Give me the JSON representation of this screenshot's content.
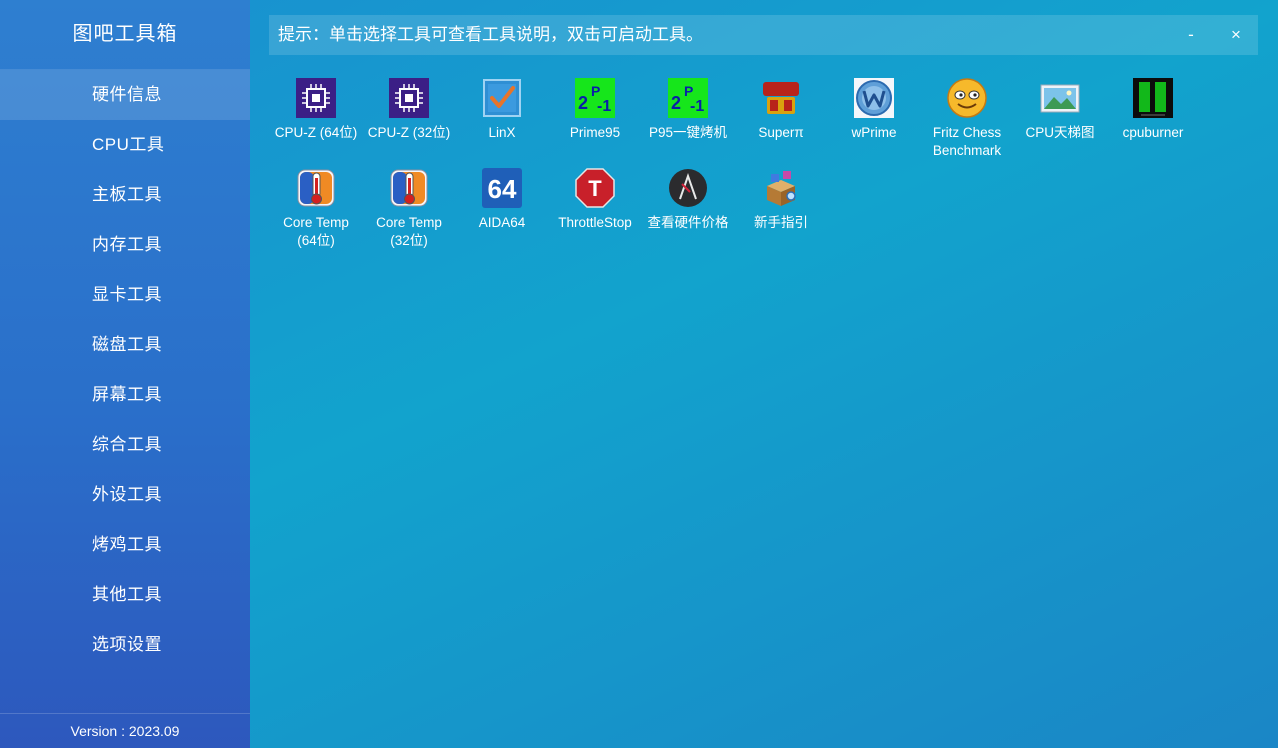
{
  "app": {
    "title": "图吧工具箱",
    "version": "Version : 2023.09"
  },
  "sidebar": {
    "items": [
      {
        "label": "硬件信息",
        "active": true
      },
      {
        "label": "CPU工具"
      },
      {
        "label": "主板工具"
      },
      {
        "label": "内存工具"
      },
      {
        "label": "显卡工具"
      },
      {
        "label": "磁盘工具"
      },
      {
        "label": "屏幕工具"
      },
      {
        "label": "综合工具"
      },
      {
        "label": "外设工具"
      },
      {
        "label": "烤鸡工具"
      },
      {
        "label": "其他工具"
      },
      {
        "label": "选项设置"
      }
    ]
  },
  "hint": {
    "text": "提示：单击选择工具可查看工具说明，双击可启动工具。",
    "minimize": "-",
    "close": "×"
  },
  "tools": [
    {
      "label": "CPU-Z (64位)",
      "icon": "cpuz-chip-icon"
    },
    {
      "label": "CPU-Z (32位)",
      "icon": "cpuz-chip-icon"
    },
    {
      "label": "LinX",
      "icon": "linx-checkbox-icon"
    },
    {
      "label": "Prime95",
      "icon": "prime95-icon"
    },
    {
      "label": "P95一键烤机",
      "icon": "prime95-icon"
    },
    {
      "label": "Superπ",
      "icon": "superpi-icon"
    },
    {
      "label": "wPrime",
      "icon": "wprime-icon"
    },
    {
      "label": "Fritz Chess\nBenchmark",
      "icon": "smiley-face-icon"
    },
    {
      "label": "CPU天梯图",
      "icon": "landscape-picture-icon"
    },
    {
      "label": "cpuburner",
      "icon": "cpuburner-bars-icon"
    },
    {
      "label": "Core Temp\n(64位)",
      "icon": "thermometer-icon"
    },
    {
      "label": "Core Temp\n(32位)",
      "icon": "thermometer-icon"
    },
    {
      "label": "AIDA64",
      "icon": "aida64-icon"
    },
    {
      "label": "ThrottleStop",
      "icon": "stop-sign-icon"
    },
    {
      "label": "查看硬件价格",
      "icon": "dark-logo-icon"
    },
    {
      "label": "新手指引",
      "icon": "package-box-icon"
    }
  ]
}
